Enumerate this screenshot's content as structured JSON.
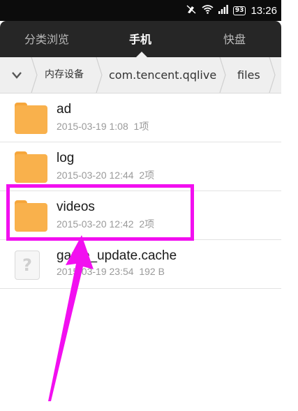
{
  "status_bar": {
    "battery": "93",
    "time": "13:26"
  },
  "tabs": [
    {
      "label": "分类浏览",
      "active": false
    },
    {
      "label": "手机",
      "active": true
    },
    {
      "label": "快盘",
      "active": false
    }
  ],
  "breadcrumb": {
    "items": [
      "内存设备",
      "com.tencent.qqlive",
      "files"
    ]
  },
  "files": [
    {
      "name": "ad",
      "date": "2015-03-19 1:08",
      "info": "1项",
      "type": "folder"
    },
    {
      "name": "log",
      "date": "2015-03-20 12:44",
      "info": "2项",
      "type": "folder"
    },
    {
      "name": "videos",
      "date": "2015-03-20 12:42",
      "info": "2项",
      "type": "folder"
    },
    {
      "name": "game_update.cache",
      "date": "2015-03-19 23:54",
      "info": "192 B",
      "type": "file"
    }
  ],
  "colors": {
    "highlight": "#f20ff0",
    "folder": "#f9b14c",
    "tab_bar": "#262626"
  }
}
